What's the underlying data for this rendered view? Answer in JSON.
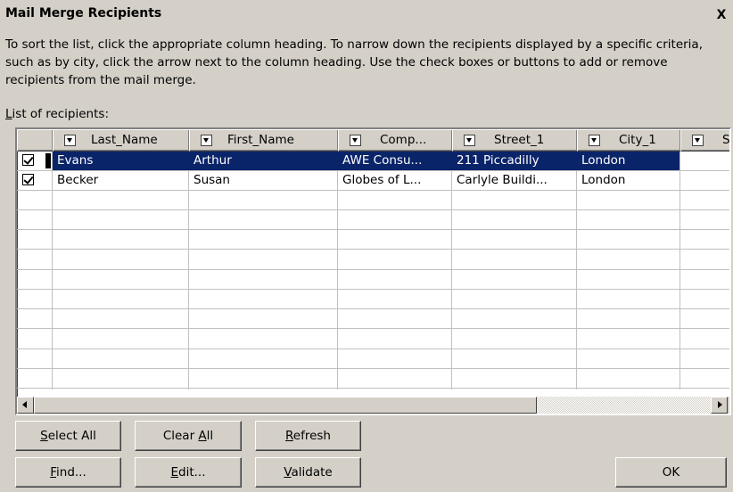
{
  "window": {
    "title": "Mail Merge Recipients",
    "close_label": "X"
  },
  "instructions": "To sort the list, click the appropriate column heading.  To narrow down the recipients displayed by a specific criteria, such as by city, click the arrow next to the column heading.  Use the check boxes or buttons to add or remove recipients from the mail merge.",
  "list_label": {
    "mnemonic": "L",
    "rest": "ist of recipients:"
  },
  "columns": [
    "Last_Name",
    "First_Name",
    "Comp...",
    "Street_1",
    "City_1",
    "S"
  ],
  "rows": [
    {
      "checked": true,
      "selected": true,
      "cells": [
        "Evans",
        "Arthur",
        "AWE Consu...",
        "211 Piccadilly",
        "London",
        ""
      ]
    },
    {
      "checked": true,
      "selected": false,
      "cells": [
        "Becker",
        "Susan",
        "Globes of L...",
        "Carlyle Buildi...",
        "London",
        ""
      ]
    }
  ],
  "buttons": {
    "select_all": {
      "mnemonic": "S",
      "rest": "elect All"
    },
    "clear_all": {
      "pre": "Clear ",
      "mnemonic": "A",
      "rest": "ll"
    },
    "refresh": {
      "mnemonic": "R",
      "rest": "efresh"
    },
    "find": {
      "mnemonic": "F",
      "rest": "ind..."
    },
    "edit": {
      "mnemonic": "E",
      "rest": "dit..."
    },
    "validate": {
      "mnemonic": "V",
      "rest": "alidate"
    },
    "ok": "OK"
  },
  "colors": {
    "selection": "#0a246a",
    "face": "#d4d0c8"
  }
}
